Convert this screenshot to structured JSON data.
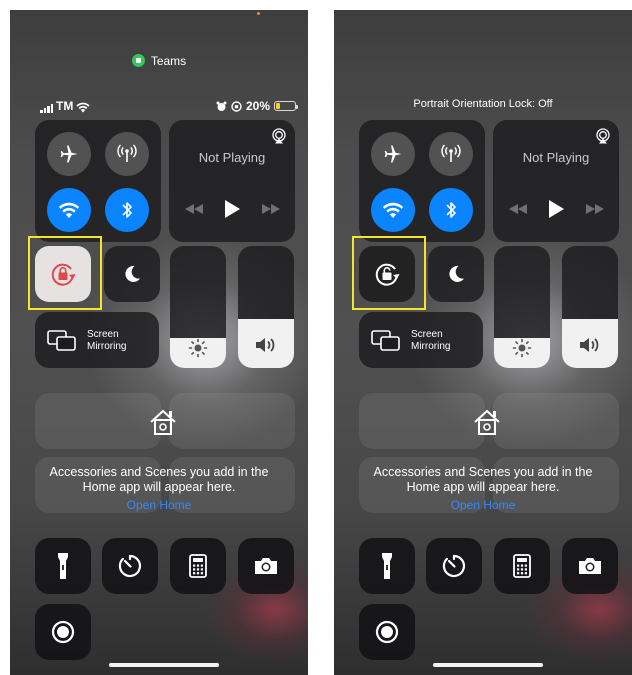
{
  "left_screen": {
    "notification_app": "Teams",
    "status": {
      "carrier": "TM",
      "battery": "20%",
      "battery_fraction": 0.2
    },
    "orientation_lock_active": true
  },
  "right_screen": {
    "orientation_message": "Portrait Orientation Lock: Off",
    "orientation_lock_active": false
  },
  "media": {
    "now_playing": "Not Playing"
  },
  "screen_mirroring": {
    "line1": "Screen",
    "line2": "Mirroring"
  },
  "home": {
    "hint_line1": "Accessories and Scenes you add in the",
    "hint_line2": "Home app will appear here.",
    "link": "Open Home"
  },
  "sliders": {
    "brightness_level": 0.25,
    "volume_level": 0.4
  },
  "colors": {
    "highlight": "#f5e52a",
    "active_blue": "#0a84ff",
    "lock_red": "#e0484e",
    "battery_yellow": "#f7cf2b",
    "link_blue": "#2f8cff"
  },
  "icons": [
    "airplane-mode-icon",
    "cellular-icon",
    "wifi-icon",
    "bluetooth-icon",
    "airplay-icon",
    "rewind-icon",
    "play-icon",
    "fast-forward-icon",
    "orientation-lock-icon",
    "moon-icon",
    "brightness-icon",
    "volume-icon",
    "screen-mirroring-icon",
    "home-icon",
    "flashlight-icon",
    "timer-icon",
    "calculator-icon",
    "camera-icon",
    "screen-record-icon"
  ]
}
